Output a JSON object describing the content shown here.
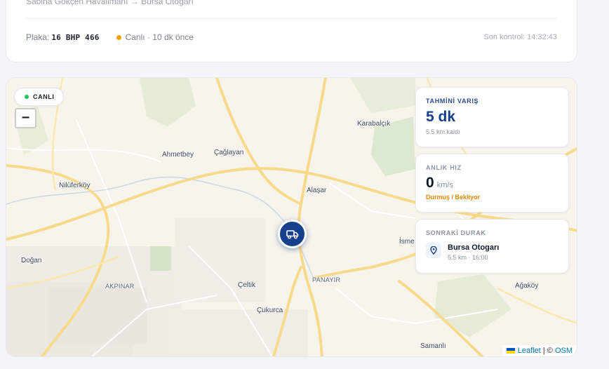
{
  "trip": {
    "route_text": "Sabiha Gökçen Havalimanı → Bursa Otogarı",
    "plate_label": "Plaka:",
    "plate_value": "16 BHP 466",
    "live_text": "Canlı · 10 dk önce",
    "last_check": "Son kontrol: 14:32:43",
    "status_color": "#f59e0b"
  },
  "map": {
    "live_badge": "CANLI",
    "zoom_out": "−",
    "vehicle_icon": "truck-icon",
    "places": [
      {
        "name": "Karabalçık"
      },
      {
        "name": "Ahmetbey"
      },
      {
        "name": "Çağlayan"
      },
      {
        "name": "Nilüferköy"
      },
      {
        "name": "Alaşar"
      },
      {
        "name": "İsme"
      },
      {
        "name": "Doğan"
      },
      {
        "name": "AKPINAR"
      },
      {
        "name": "Çeltik"
      },
      {
        "name": "PANAYIR"
      },
      {
        "name": "Ağaköy"
      },
      {
        "name": "Çukurca"
      },
      {
        "name": "Samanlı"
      }
    ],
    "attribution": {
      "leaflet": "Leaflet",
      "separator": " | © ",
      "osm": "OSM"
    }
  },
  "eta_card": {
    "title": "TAHMİNİ VARIŞ",
    "value": "5 dk",
    "remaining": "5.5 km kaldı"
  },
  "speed_card": {
    "title": "ANLIK HIZ",
    "value": "0",
    "unit": "km/s",
    "status": "Durmuş / Bekliyor"
  },
  "next_stop_card": {
    "title": "SONRAKİ DURAK",
    "name": "Bursa Otogarı",
    "meta": "5.5 km · 16:00"
  },
  "colors": {
    "accent": "#163f8c",
    "live": "#22c55e",
    "warning": "#e0860b"
  }
}
